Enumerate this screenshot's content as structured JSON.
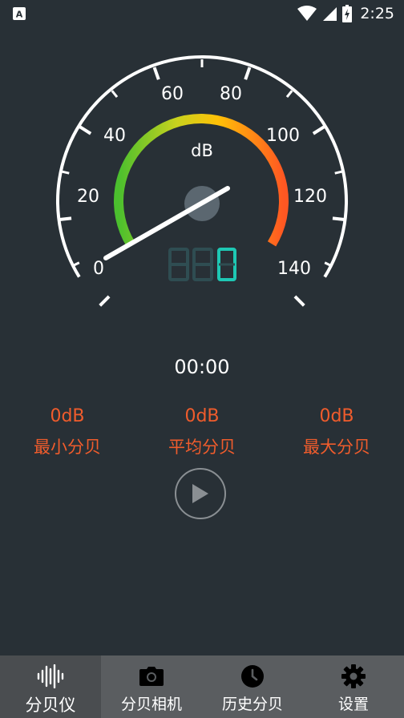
{
  "status_bar": {
    "time": "2:25"
  },
  "gauge": {
    "unit": "dB",
    "min": 0,
    "max": 140,
    "tick_labels": [
      "0",
      "20",
      "40",
      "60",
      "80",
      "100",
      "120",
      "140"
    ],
    "needle_value": 0,
    "digit_display": "0"
  },
  "timer": "00:00",
  "stats": [
    {
      "value": "0dB",
      "label": "最小分贝"
    },
    {
      "value": "0dB",
      "label": "平均分贝"
    },
    {
      "value": "0dB",
      "label": "最大分贝"
    }
  ],
  "bottom_nav": [
    {
      "label": "分贝仪",
      "icon": "sound-wave-icon",
      "active": true
    },
    {
      "label": "分贝相机",
      "icon": "camera-icon",
      "active": false
    },
    {
      "label": "历史分贝",
      "icon": "clock-icon",
      "active": false
    },
    {
      "label": "设置",
      "icon": "gear-icon",
      "active": false
    }
  ],
  "colors": {
    "background": "#283036",
    "accent": "#f05c2c",
    "digit": "#1ec8b4",
    "nav": "#5a5d60"
  }
}
